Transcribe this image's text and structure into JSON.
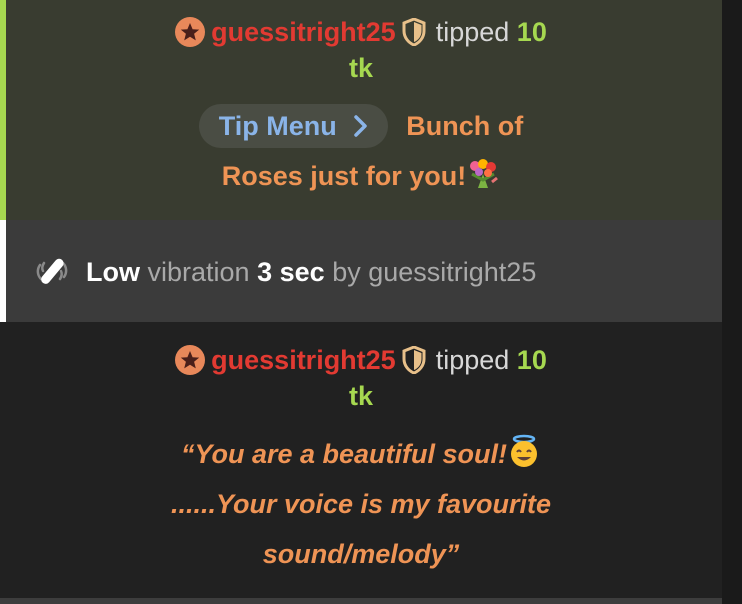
{
  "messages": [
    {
      "user": "guessitright25",
      "verb": "tipped",
      "amount": "10",
      "unit": "tk",
      "tip_menu_label": "Tip Menu",
      "text_part1": "Bunch of",
      "text_part2": "Roses just for you!"
    },
    {
      "level": "Low",
      "word_vibration": "vibration",
      "duration": "3 sec",
      "word_by": "by",
      "user": "guessitright25"
    },
    {
      "user": "guessitright25",
      "verb": "tipped",
      "amount": "10",
      "unit": "tk",
      "quote_line1": "“You are a beautiful soul!",
      "quote_line2": "......Your voice is my favourite",
      "quote_line3": "sound/melody”"
    }
  ],
  "colors": {
    "username": "#e23a32",
    "amount": "#a6d850",
    "tip_text": "#ef9455",
    "tip_menu": "#8ab4e8",
    "accent_tip": "#a6d850",
    "accent_vibe": "#ffffff"
  },
  "icons": {
    "avatar": "star-badge-icon",
    "badge": "shield-icon",
    "menu_arrow": "chevron-right-icon",
    "vibration": "vibration-device-icon",
    "roses": "bouquet-icon",
    "halo": "halo-smiley-icon"
  }
}
